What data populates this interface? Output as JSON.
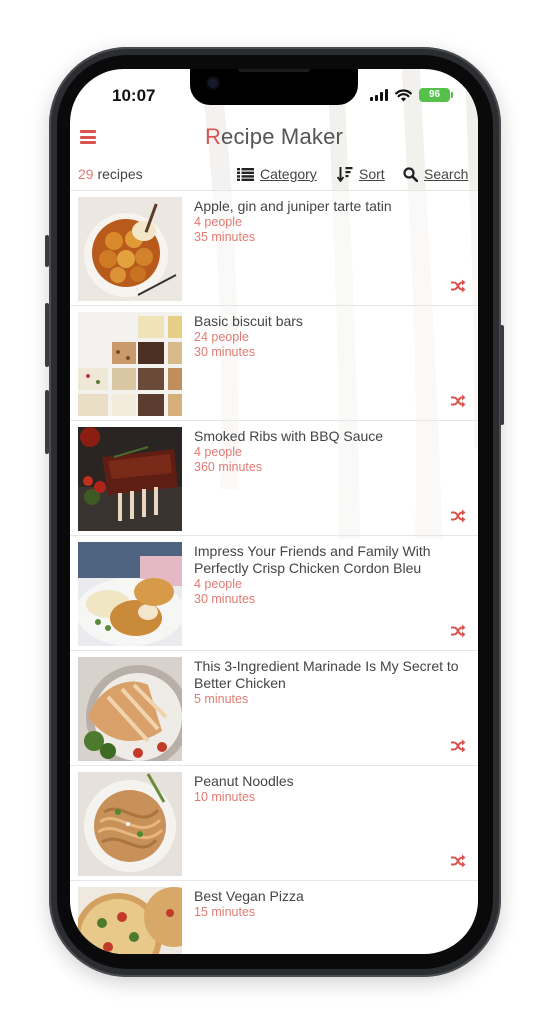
{
  "status": {
    "time": "10:07",
    "battery": "96"
  },
  "header": {
    "title_first": "R",
    "title_rest": "ecipe Maker"
  },
  "toolbar": {
    "count": "29",
    "count_suffix": "recipes",
    "category_label": "Category",
    "sort_label": "Sort",
    "search_label": "Search"
  },
  "colors": {
    "accent": "#d9534f",
    "meta": "#e07b73",
    "text": "#444444",
    "battery": "#55c14a"
  },
  "recipes": [
    {
      "title": "Apple, gin and juniper tarte tatin",
      "people": "4 people",
      "time": "35 minutes"
    },
    {
      "title": "Basic biscuit bars",
      "people": "24 people",
      "time": "30 minutes"
    },
    {
      "title": "Smoked Ribs with BBQ Sauce",
      "people": "4 people",
      "time": "360 minutes"
    },
    {
      "title": "Impress Your Friends and Family With Perfectly Crisp Chicken Cordon Bleu",
      "people": "4 people",
      "time": "30 minutes"
    },
    {
      "title": "This 3-Ingredient Marinade Is My Secret to Better Chicken",
      "time": "5 minutes"
    },
    {
      "title": "Peanut Noodles",
      "time": "10 minutes"
    },
    {
      "title": "Best Vegan Pizza",
      "time": "15 minutes"
    }
  ],
  "icons": {
    "menu": "hamburger-icon",
    "category": "list-icon",
    "sort": "sort-icon",
    "search": "search-icon",
    "shuffle": "shuffle-icon"
  }
}
